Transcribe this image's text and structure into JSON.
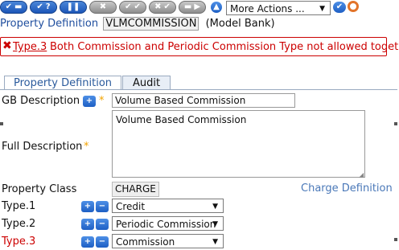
{
  "toolbar": {
    "more_actions": "More Actions ..."
  },
  "header": {
    "label": "Property Definition",
    "record_id": "VLMCOMMISSION",
    "company": "(Model Bank)"
  },
  "error": {
    "field": "Type.3",
    "message": "Both Commission and Periodic Commission Type not allowed together"
  },
  "tabs": [
    {
      "label": "Property Definition"
    },
    {
      "label": "Audit"
    }
  ],
  "form": {
    "gb_description_label": "GB Description",
    "gb_description_value": "Volume Based Commission",
    "full_description_label": "Full Description",
    "full_description_value": "Volume Based Commission",
    "property_class_label": "Property Class",
    "property_class_value": "CHARGE",
    "charge_definition_link": "Charge Definition",
    "types": [
      {
        "label": "Type.1",
        "value": "Credit"
      },
      {
        "label": "Type.2",
        "value": "Periodic Commission"
      },
      {
        "label": "Type.3",
        "value": "Commission"
      }
    ]
  },
  "colors": {
    "error_red": "#cc0000",
    "header_blue": "#1f4e9e",
    "tab_blue": "#2a5a9c",
    "link_blue": "#4a78b8"
  }
}
